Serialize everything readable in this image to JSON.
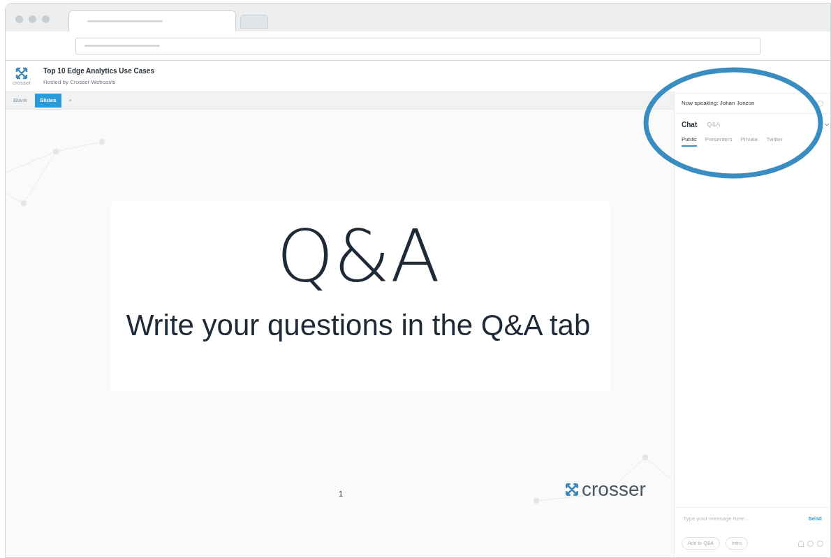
{
  "header": {
    "logo_text": "crosser",
    "title": "Top 10 Edge Analytics Use Cases",
    "subtitle": "Hosted by Crosser Webcasts"
  },
  "view_tabs": [
    {
      "label": "Blank",
      "selected": false
    },
    {
      "label": "Slides",
      "selected": true
    },
    {
      "label": "+",
      "selected": false
    }
  ],
  "slide": {
    "heading": "Q&A",
    "text": "Write your questions in the Q&A tab",
    "page": "1",
    "logo_text": "crosser"
  },
  "panel": {
    "now_speaking": "Now speaking: Johan Jonzon",
    "tabs": [
      {
        "label": "Chat",
        "selected": true
      },
      {
        "label": "Q&A",
        "selected": false
      }
    ],
    "chat_tabs": [
      {
        "label": "Public",
        "selected": true
      },
      {
        "label": "Presenters",
        "selected": false
      },
      {
        "label": "Private",
        "selected": false
      },
      {
        "label": "Twitter",
        "selected": false
      }
    ],
    "message": {
      "placeholder": "Type your message here..."
    },
    "send": "Send",
    "buttons": [
      "Add to Q&A",
      "Intro"
    ]
  }
}
